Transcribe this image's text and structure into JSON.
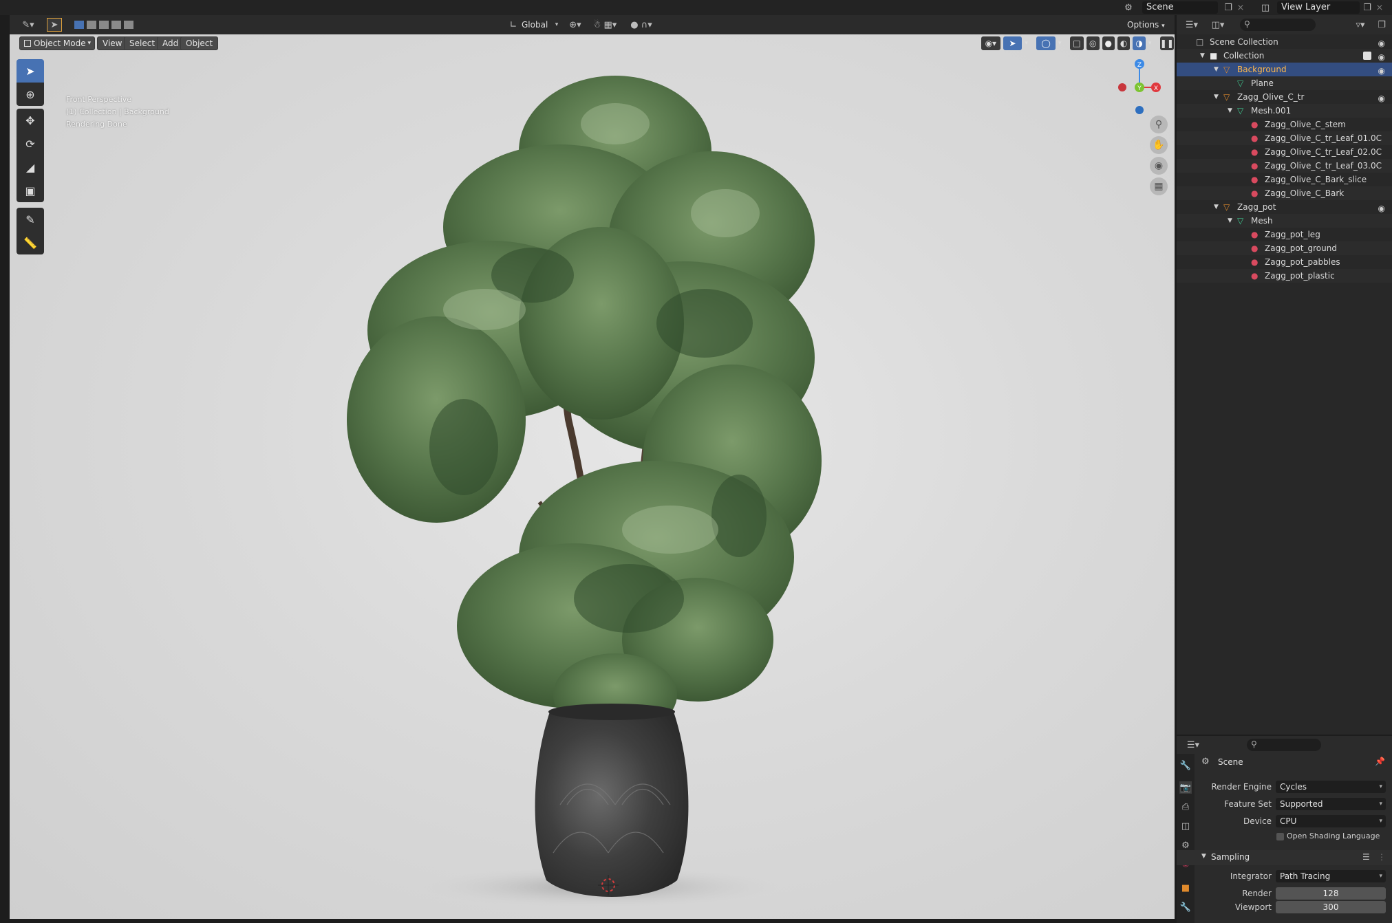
{
  "topbar": {
    "scene_label": "Scene",
    "view_layer_label": "View Layer"
  },
  "viewport_header": {
    "transform_orientation": "Global",
    "options_label": "Options",
    "mode_label": "Object Mode",
    "menus": [
      "View",
      "Select",
      "Add",
      "Object"
    ]
  },
  "viewport_info": {
    "line1": "Front Perspective",
    "line2": "(1) Collection | Background",
    "line3": "Rendering Done"
  },
  "gizmo": {
    "z": "Z",
    "y": "Y",
    "x": "X"
  },
  "outliner": {
    "rows": [
      {
        "label": "Scene Collection",
        "type": "scene-collection"
      },
      {
        "label": "Collection",
        "type": "collection"
      },
      {
        "label": "Background",
        "type": "object",
        "selected": true
      },
      {
        "label": "Plane",
        "type": "mesh"
      },
      {
        "label": "Zagg_Olive_C_tr",
        "type": "object"
      },
      {
        "label": "Mesh.001",
        "type": "mesh"
      },
      {
        "label": "Zagg_Olive_C_stem",
        "type": "material"
      },
      {
        "label": "Zagg_Olive_C_tr_Leaf_01.0C",
        "type": "material"
      },
      {
        "label": "Zagg_Olive_C_tr_Leaf_02.0C",
        "type": "material"
      },
      {
        "label": "Zagg_Olive_C_tr_Leaf_03.0C",
        "type": "material"
      },
      {
        "label": "Zagg_Olive_C_Bark_slice",
        "type": "material"
      },
      {
        "label": "Zagg_Olive_C_Bark",
        "type": "material"
      },
      {
        "label": "Zagg_pot",
        "type": "object"
      },
      {
        "label": "Mesh",
        "type": "mesh"
      },
      {
        "label": "Zagg_pot_leg",
        "type": "material"
      },
      {
        "label": "Zagg_pot_ground",
        "type": "material"
      },
      {
        "label": "Zagg_pot_pabbles",
        "type": "material"
      },
      {
        "label": "Zagg_pot_plastic",
        "type": "material"
      }
    ]
  },
  "properties": {
    "context_label": "Scene",
    "render_engine_label": "Render Engine",
    "render_engine_value": "Cycles",
    "feature_set_label": "Feature Set",
    "feature_set_value": "Supported",
    "device_label": "Device",
    "device_value": "CPU",
    "osl_label": "Open Shading Language",
    "sampling_label": "Sampling",
    "integrator_label": "Integrator",
    "integrator_value": "Path Tracing",
    "render_label": "Render",
    "render_value": "128",
    "viewport_label": "Viewport",
    "viewport_value": "300"
  },
  "colors": {
    "accent": "#4772b3",
    "selected_row": "#334d80",
    "axis_x": "#e0393e",
    "axis_y": "#7cc431",
    "axis_z": "#3c8ae6"
  }
}
